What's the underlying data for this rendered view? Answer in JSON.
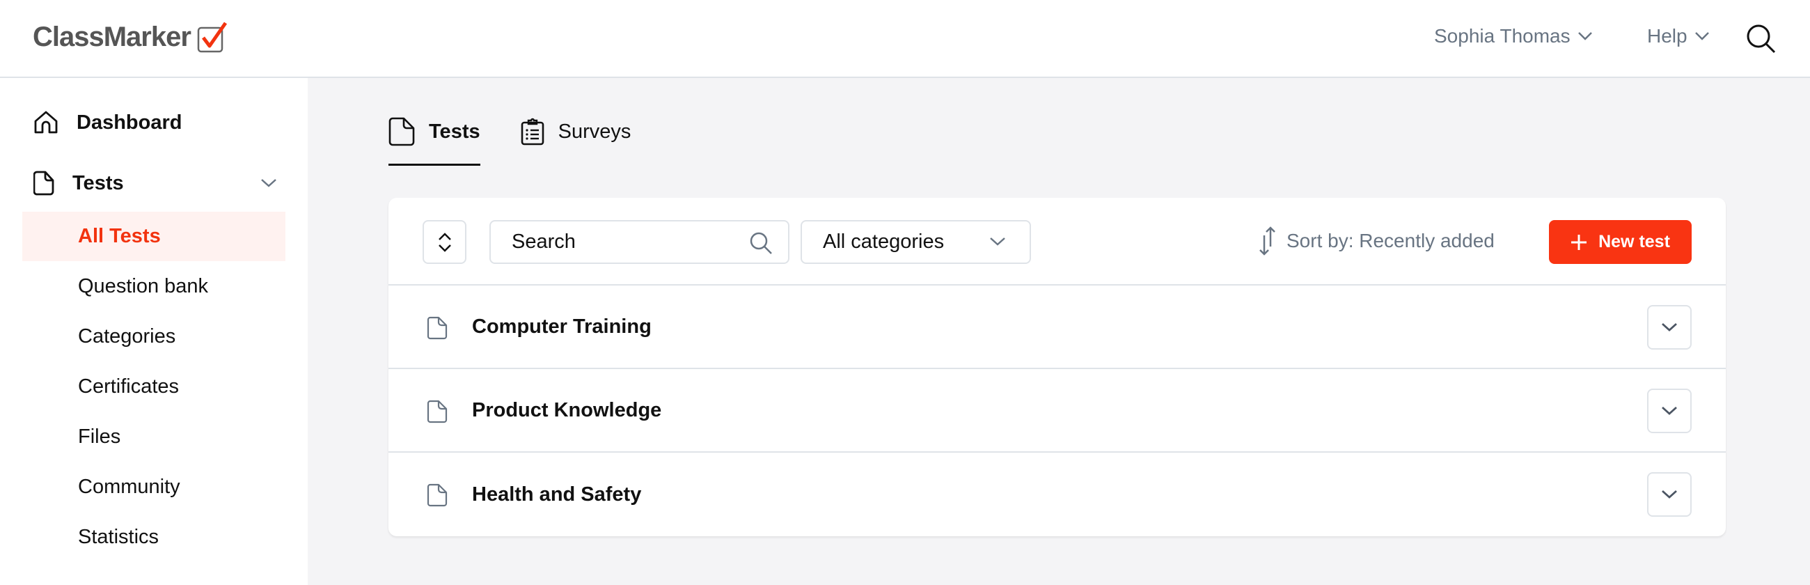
{
  "header": {
    "logo": "ClassMarker",
    "user_menu": "Sophia Thomas",
    "help_menu": "Help"
  },
  "sidebar": {
    "dashboard": "Dashboard",
    "tests": "Tests",
    "sub_items": [
      {
        "label": "All Tests",
        "active": true
      },
      {
        "label": "Question bank"
      },
      {
        "label": "Categories"
      },
      {
        "label": "Certificates"
      },
      {
        "label": "Files"
      },
      {
        "label": "Community"
      },
      {
        "label": "Statistics"
      }
    ]
  },
  "tabs": [
    {
      "label": "Tests",
      "active": true
    },
    {
      "label": "Surveys"
    }
  ],
  "toolbar": {
    "search_placeholder": "Search",
    "category_selected": "All categories",
    "sort_label": "Sort by: Recently added",
    "new_test_label": "New test"
  },
  "tests": [
    {
      "title": "Computer Training"
    },
    {
      "title": "Product Knowledge"
    },
    {
      "title": "Health and Safety"
    }
  ],
  "colors": {
    "accent": "#f93412",
    "active_bg": "#fff2f0",
    "muted_text": "#687482",
    "border": "#dfe3e8"
  }
}
